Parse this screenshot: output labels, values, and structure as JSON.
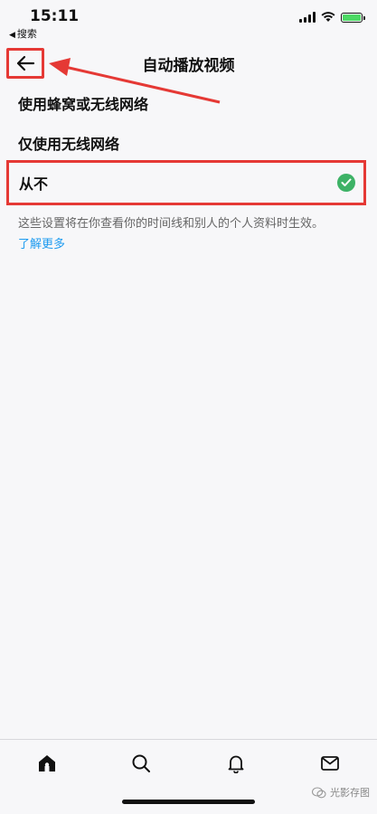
{
  "status_bar": {
    "time": "15:11",
    "back_app": "搜索"
  },
  "header": {
    "title": "自动播放视频"
  },
  "options": [
    {
      "label": "使用蜂窝或无线网络",
      "selected": false
    },
    {
      "label": "仅使用无线网络",
      "selected": false
    },
    {
      "label": "从不",
      "selected": true
    }
  ],
  "note": "这些设置将在你查看你的时间线和别人的个人资料时生效。",
  "learn_more": "了解更多",
  "bottom_nav": {
    "items": [
      "home-icon",
      "search-icon",
      "notifications-icon",
      "messages-icon"
    ]
  },
  "watermark": "光影存图",
  "colors": {
    "accent": "#1d9bf0",
    "check": "#3db266",
    "annotation": "#e53935"
  }
}
